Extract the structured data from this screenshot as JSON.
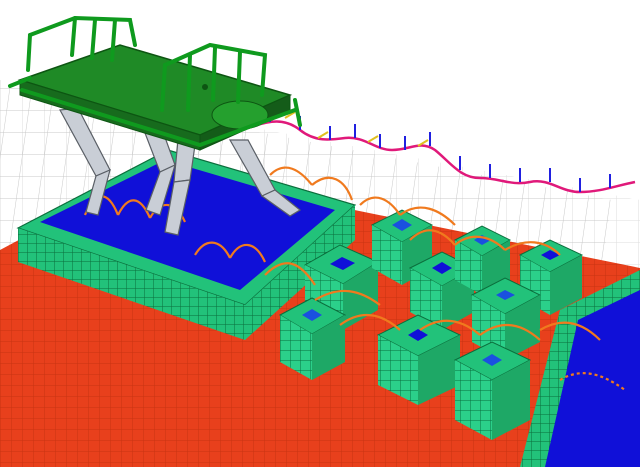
{
  "scene": {
    "kind": "robot-terrain-simulation",
    "elements": [
      "quadruped-robot",
      "height-map-terrain",
      "foot-trajectories",
      "body-path",
      "stepping-stones",
      "ground-grid"
    ]
  },
  "colors": {
    "background": "#ffffff",
    "ground_grid": "#c8c8c8",
    "lava": "#e8401c",
    "platform_top": "#1010d8",
    "cell_green": "#22c27a",
    "cell_dark": "#0b8a4a",
    "cell_cyan": "#2ee0b0",
    "robot_body": "#1f8a26",
    "robot_frame": "#0f7a1a",
    "robot_legs": "#c9ced6",
    "foot_trajectory": "#f07a1e",
    "body_path": "#e0197a",
    "path_ticks_blue": "#2020e0",
    "path_ticks_yellow": "#e0c020"
  }
}
